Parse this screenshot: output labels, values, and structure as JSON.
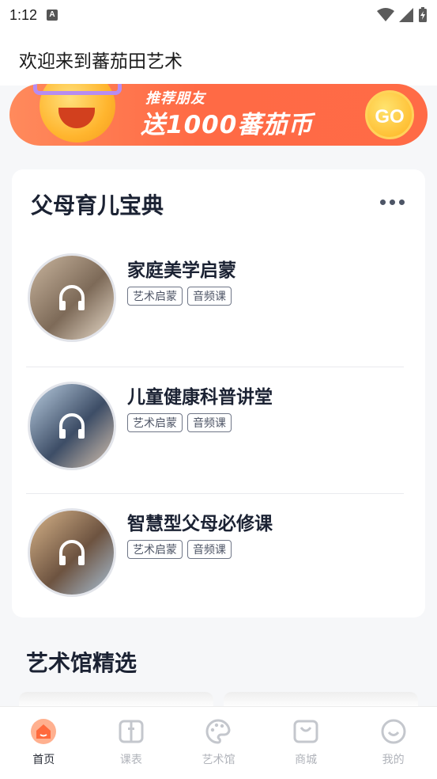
{
  "status_bar": {
    "time": "1:12",
    "notification_icon": "a-notification-icon"
  },
  "header": {
    "welcome": "欢迎来到蕃茄田艺术"
  },
  "banner": {
    "tag": "推荐朋友",
    "headline": "送1000蕃茄币",
    "go": "GO"
  },
  "parenting_card": {
    "title": "父母育儿宝典",
    "courses": [
      {
        "title": "家庭美学启蒙",
        "tags": [
          "艺术启蒙",
          "音频课"
        ],
        "palette": [
          "#c9b59e",
          "#7d6a58",
          "#e9dccb"
        ]
      },
      {
        "title": "儿童健康科普讲堂",
        "tags": [
          "艺术启蒙",
          "音频课"
        ],
        "palette": [
          "#b9cde0",
          "#3d4d66",
          "#d8c4b0"
        ]
      },
      {
        "title": "智慧型父母必修课",
        "tags": [
          "艺术启蒙",
          "音频课"
        ],
        "palette": [
          "#d7b48a",
          "#6d5340",
          "#a9c2d8"
        ]
      }
    ]
  },
  "art_gallery": {
    "title": "艺术馆精选"
  },
  "tabbar": {
    "items": [
      {
        "label": "首页",
        "icon": "home-icon",
        "active": true
      },
      {
        "label": "课表",
        "icon": "schedule-icon",
        "active": false
      },
      {
        "label": "艺术馆",
        "icon": "palette-icon",
        "active": false
      },
      {
        "label": "商城",
        "icon": "shop-bag-icon",
        "active": false
      },
      {
        "label": "我的",
        "icon": "smile-profile-icon",
        "active": false
      }
    ],
    "accent": "#ff6a3d",
    "inactive": "#c4c7cd"
  }
}
